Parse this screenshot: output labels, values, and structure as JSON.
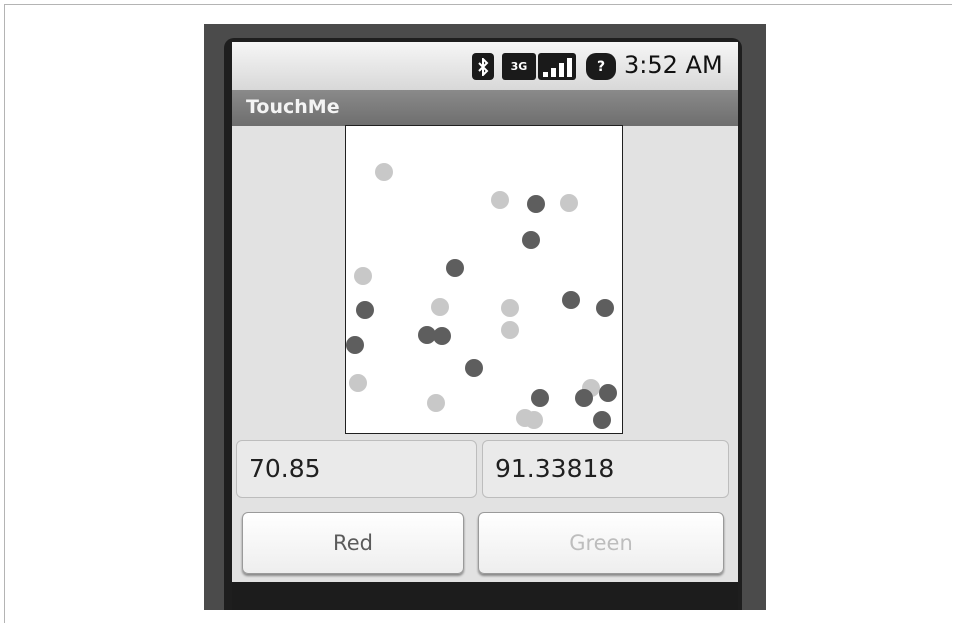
{
  "status_bar": {
    "time": "3:52 AM",
    "icons": [
      "bluetooth-icon",
      "3g-icon",
      "signal-icon",
      "battery-unknown-icon"
    ],
    "network_label": "3G",
    "battery_label": "?"
  },
  "app": {
    "title": "TouchMe"
  },
  "canvas": {
    "dots": [
      {
        "color": "#c8c8c8"
      },
      {
        "color": "#c8c8c8"
      },
      {
        "color": "#5e5e5e"
      },
      {
        "color": "#c8c8c8"
      },
      {
        "color": "#5e5e5e"
      },
      {
        "color": "#5e5e5e"
      },
      {
        "color": "#c8c8c8"
      },
      {
        "color": "#5e5e5e"
      },
      {
        "color": "#5e5e5e"
      },
      {
        "color": "#c8c8c8"
      },
      {
        "color": "#c8c8c8"
      },
      {
        "color": "#5e5e5e"
      },
      {
        "color": "#5e5e5e"
      },
      {
        "color": "#5e5e5e"
      },
      {
        "color": "#c8c8c8"
      },
      {
        "color": "#5e5e5e"
      },
      {
        "color": "#5e5e5e"
      },
      {
        "color": "#c8c8c8"
      },
      {
        "color": "#c8c8c8"
      },
      {
        "color": "#5e5e5e"
      },
      {
        "color": "#c8c8c8"
      },
      {
        "color": "#c8c8c8"
      },
      {
        "color": "#5e5e5e"
      },
      {
        "color": "#c8c8c8"
      },
      {
        "color": "#5e5e5e"
      },
      {
        "color": "#5e5e5e"
      }
    ]
  },
  "fields": {
    "x_value": "70.85",
    "y_value": "91.33818"
  },
  "buttons": {
    "red_label": "Red",
    "green_label": "Green"
  }
}
